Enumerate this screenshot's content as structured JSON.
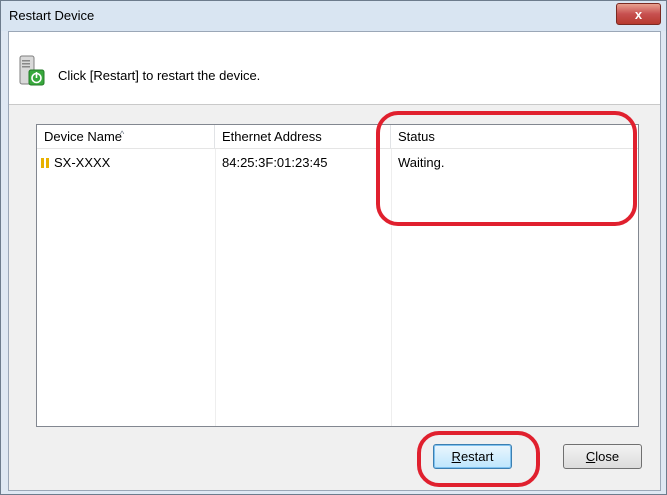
{
  "window": {
    "title": "Restart Device",
    "close_glyph": "x"
  },
  "header": {
    "icon": "device-restart-icon",
    "message": "Click [Restart] to restart the device."
  },
  "list": {
    "columns": [
      "Device Name",
      "Ethernet Address",
      "Status"
    ],
    "rows": [
      {
        "name": "SX-XXXX",
        "ethernet": "84:25:3F:01:23:45",
        "status": "Waiting."
      }
    ]
  },
  "buttons": {
    "restart_rest": "estart",
    "restart_mnemonic": "R",
    "close_rest": "lose",
    "close_mnemonic": "C"
  },
  "colors": {
    "highlight_ring": "#e0202e",
    "device_glyph": "#e8b100"
  }
}
